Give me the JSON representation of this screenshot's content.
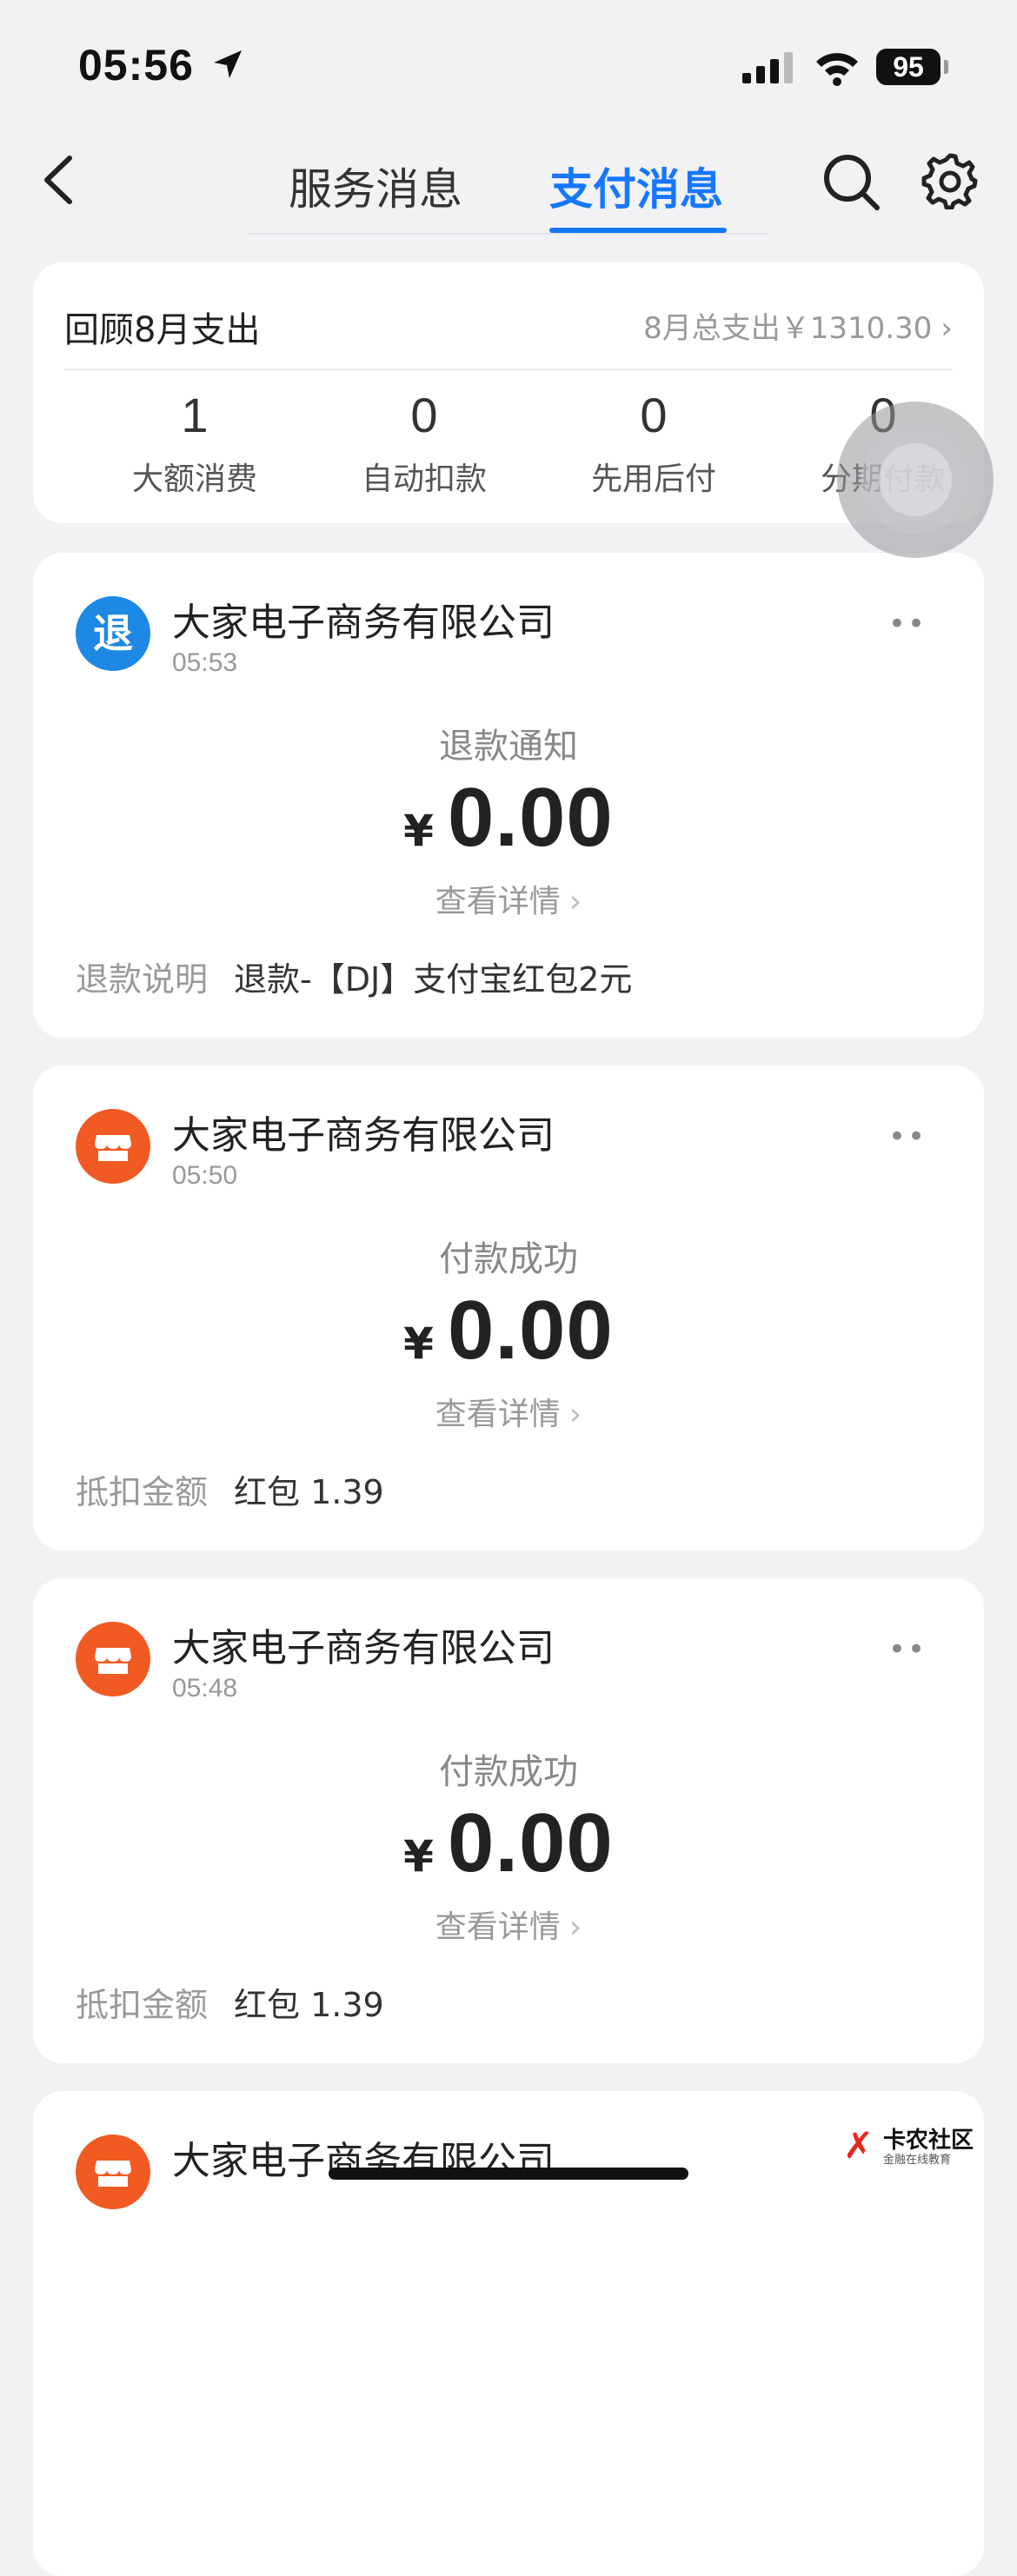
{
  "status_bar": {
    "time": "05:56",
    "battery": "95"
  },
  "nav": {
    "tabs": [
      "服务消息",
      "支付消息"
    ],
    "active_tab": "支付消息"
  },
  "summary": {
    "title": "回顾8月支出",
    "total": "8月总支出￥1310.30",
    "stats": [
      {
        "value": "1",
        "label": "大额消费"
      },
      {
        "value": "0",
        "label": "自动扣款"
      },
      {
        "value": "0",
        "label": "先用后付"
      },
      {
        "value": "0",
        "label": "分期付款"
      }
    ]
  },
  "messages": [
    {
      "icon": "refund",
      "avatar_text": "退",
      "merchant": "大家电子商务有限公司",
      "time": "05:53",
      "type": "退款通知",
      "currency": "¥",
      "amount": "0.00",
      "detail": "查看详情",
      "bottom_label": "退款说明",
      "bottom_value": "退款-【DJ】支付宝红包2元"
    },
    {
      "icon": "shop",
      "merchant": "大家电子商务有限公司",
      "time": "05:50",
      "type": "付款成功",
      "currency": "¥",
      "amount": "0.00",
      "detail": "查看详情",
      "bottom_label": "抵扣金额",
      "bottom_value": "红包 1.39"
    },
    {
      "icon": "shop",
      "merchant": "大家电子商务有限公司",
      "time": "05:48",
      "type": "付款成功",
      "currency": "¥",
      "amount": "0.00",
      "detail": "查看详情",
      "bottom_label": "抵扣金额",
      "bottom_value": "红包 1.39"
    },
    {
      "icon": "shop",
      "merchant": "大家电子商务有限公司"
    }
  ],
  "watermark": {
    "name": "卡农社区",
    "tagline": "金融在线教育"
  },
  "colors": {
    "accent": "#1677ff",
    "refund_icon": "#1e88e5",
    "shop_icon": "#f25a23",
    "background": "#f2f2f5"
  }
}
